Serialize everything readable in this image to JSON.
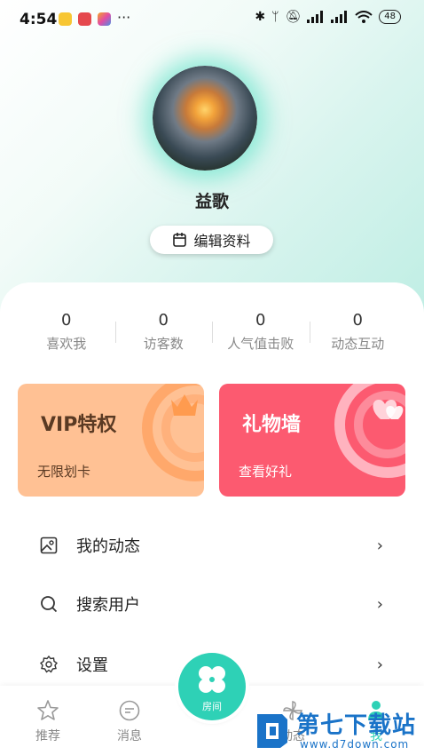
{
  "status_bar": {
    "time": "4:54",
    "more": "···",
    "battery": "48"
  },
  "profile": {
    "username": "益歌",
    "edit_label": "编辑资料"
  },
  "stats": [
    {
      "value": "0",
      "label": "喜欢我"
    },
    {
      "value": "0",
      "label": "访客数"
    },
    {
      "value": "0",
      "label": "人气值击败"
    },
    {
      "value": "0",
      "label": "动态互动"
    }
  ],
  "cards": {
    "vip": {
      "title": "VIP特权",
      "subtitle": "无限划卡"
    },
    "gift": {
      "title": "礼物墙",
      "subtitle": "查看好礼"
    }
  },
  "menu": [
    {
      "label": "我的动态",
      "icon": "image-icon"
    },
    {
      "label": "搜索用户",
      "icon": "search-icon"
    },
    {
      "label": "设置",
      "icon": "gear-icon"
    }
  ],
  "tabbar": {
    "recommend": "推荐",
    "messages": "消息",
    "center": "房间",
    "dynamic": "动态",
    "mine": "我"
  },
  "watermark": {
    "name": "第七下载站",
    "url": "www.d7down.com"
  },
  "colors": {
    "accent": "#2ed1b6",
    "vip": "#ffc194",
    "gift": "#fc5a70"
  }
}
